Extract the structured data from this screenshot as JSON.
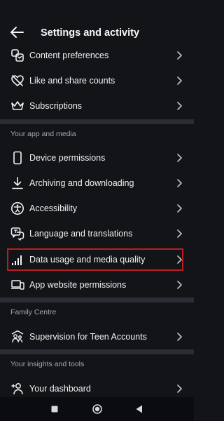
{
  "header": {
    "title": "Settings and activity"
  },
  "items": {
    "content_preferences": "Content preferences",
    "like_share_counts": "Like and share counts",
    "subscriptions": "Subscriptions",
    "device_permissions": "Device permissions",
    "archiving": "Archiving and downloading",
    "accessibility": "Accessibility",
    "language": "Language and translations",
    "data_usage": "Data usage and media quality",
    "app_website": "App website permissions",
    "supervision": "Supervision for Teen Accounts",
    "dashboard": "Your dashboard"
  },
  "sections": {
    "app_and_media": "Your app and media",
    "family_centre": "Family Centre",
    "insights_tools": "Your insights and tools"
  },
  "highlight_color": "#b61e22",
  "icons": [
    "back-arrow-icon",
    "content-preferences-icon",
    "heart-slash-icon",
    "crown-icon",
    "phone-icon",
    "download-icon",
    "accessibility-icon",
    "translate-icon",
    "signal-bars-icon",
    "laptop-phone-icon",
    "family-icon",
    "dashboard-icon"
  ]
}
